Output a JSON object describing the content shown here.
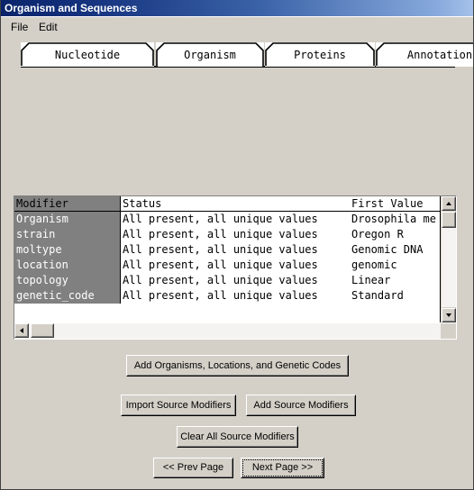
{
  "window": {
    "title": "Organism and Sequences"
  },
  "menubar": {
    "items": [
      {
        "label": "File"
      },
      {
        "label": "Edit"
      }
    ]
  },
  "tabs": {
    "selected": "Organism",
    "items": [
      {
        "label": "Nucleotide",
        "selected": false
      },
      {
        "label": "Organism",
        "selected": true
      },
      {
        "label": "Proteins",
        "selected": false
      },
      {
        "label": "Annotation",
        "selected": false
      }
    ]
  },
  "table": {
    "columns": [
      "Modifier",
      "Status",
      "First Value"
    ],
    "rows": [
      {
        "modifier": "Organism",
        "status": "All present, all unique values",
        "first_value": "Drosophila me"
      },
      {
        "modifier": "strain",
        "status": "All present, all unique values",
        "first_value": "Oregon R"
      },
      {
        "modifier": "moltype",
        "status": "All present, all unique values",
        "first_value": "Genomic DNA"
      },
      {
        "modifier": "location",
        "status": "All present, all unique values",
        "first_value": "genomic"
      },
      {
        "modifier": "topology",
        "status": "All present, all unique values",
        "first_value": "Linear"
      },
      {
        "modifier": "genetic_code",
        "status": "All present, all unique values",
        "first_value": "Standard"
      }
    ],
    "scrollbars": {
      "vertical_up_icon": "scroll-up-arrow-icon",
      "vertical_down_icon": "scroll-down-arrow-icon",
      "horizontal_left_icon": "scroll-left-arrow-icon"
    }
  },
  "buttons": {
    "add_organisms": "Add Organisms, Locations, and Genetic Codes",
    "import_source_modifiers": "Import Source Modifiers",
    "add_source_modifiers": "Add Source Modifiers",
    "clear_all_source_modifiers": "Clear All Source Modifiers",
    "prev_page": "<< Prev Page",
    "next_page": "Next Page >>"
  },
  "colors": {
    "titlebar_dark": "#0a246a",
    "titlebar_light": "#a7c3ea",
    "window_face": "#d4d0c8",
    "selection": "#808080",
    "field": "#ffffff"
  }
}
